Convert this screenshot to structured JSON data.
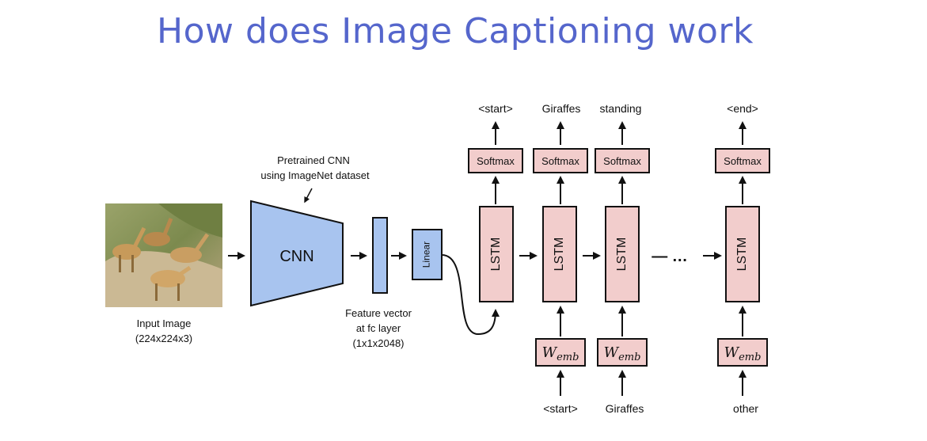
{
  "title": "How does Image Captioning work",
  "input": {
    "label": "Input Image",
    "dims": "(224x224x3)"
  },
  "cnn": {
    "label": "CNN",
    "annotation_line1": "Pretrained CNN",
    "annotation_line2": "using ImageNet dataset"
  },
  "feature": {
    "line1": "Feature vector",
    "line2": "at fc layer",
    "line3": "(1x1x2048)"
  },
  "linear_label": "Linear",
  "lstm_label": "LSTM",
  "softmax_label": "Softmax",
  "wemb": {
    "base": "W",
    "sub": "emb"
  },
  "dots": "— …",
  "outputs": [
    "<start>",
    "Giraffes",
    "standing",
    "<end>"
  ],
  "inputs": [
    "<start>",
    "Giraffes",
    "other"
  ],
  "colors": {
    "title": "#5566cc",
    "cnn_fill": "#a8c4ef",
    "box_fill": "#f2cdcc",
    "border": "#111111"
  }
}
